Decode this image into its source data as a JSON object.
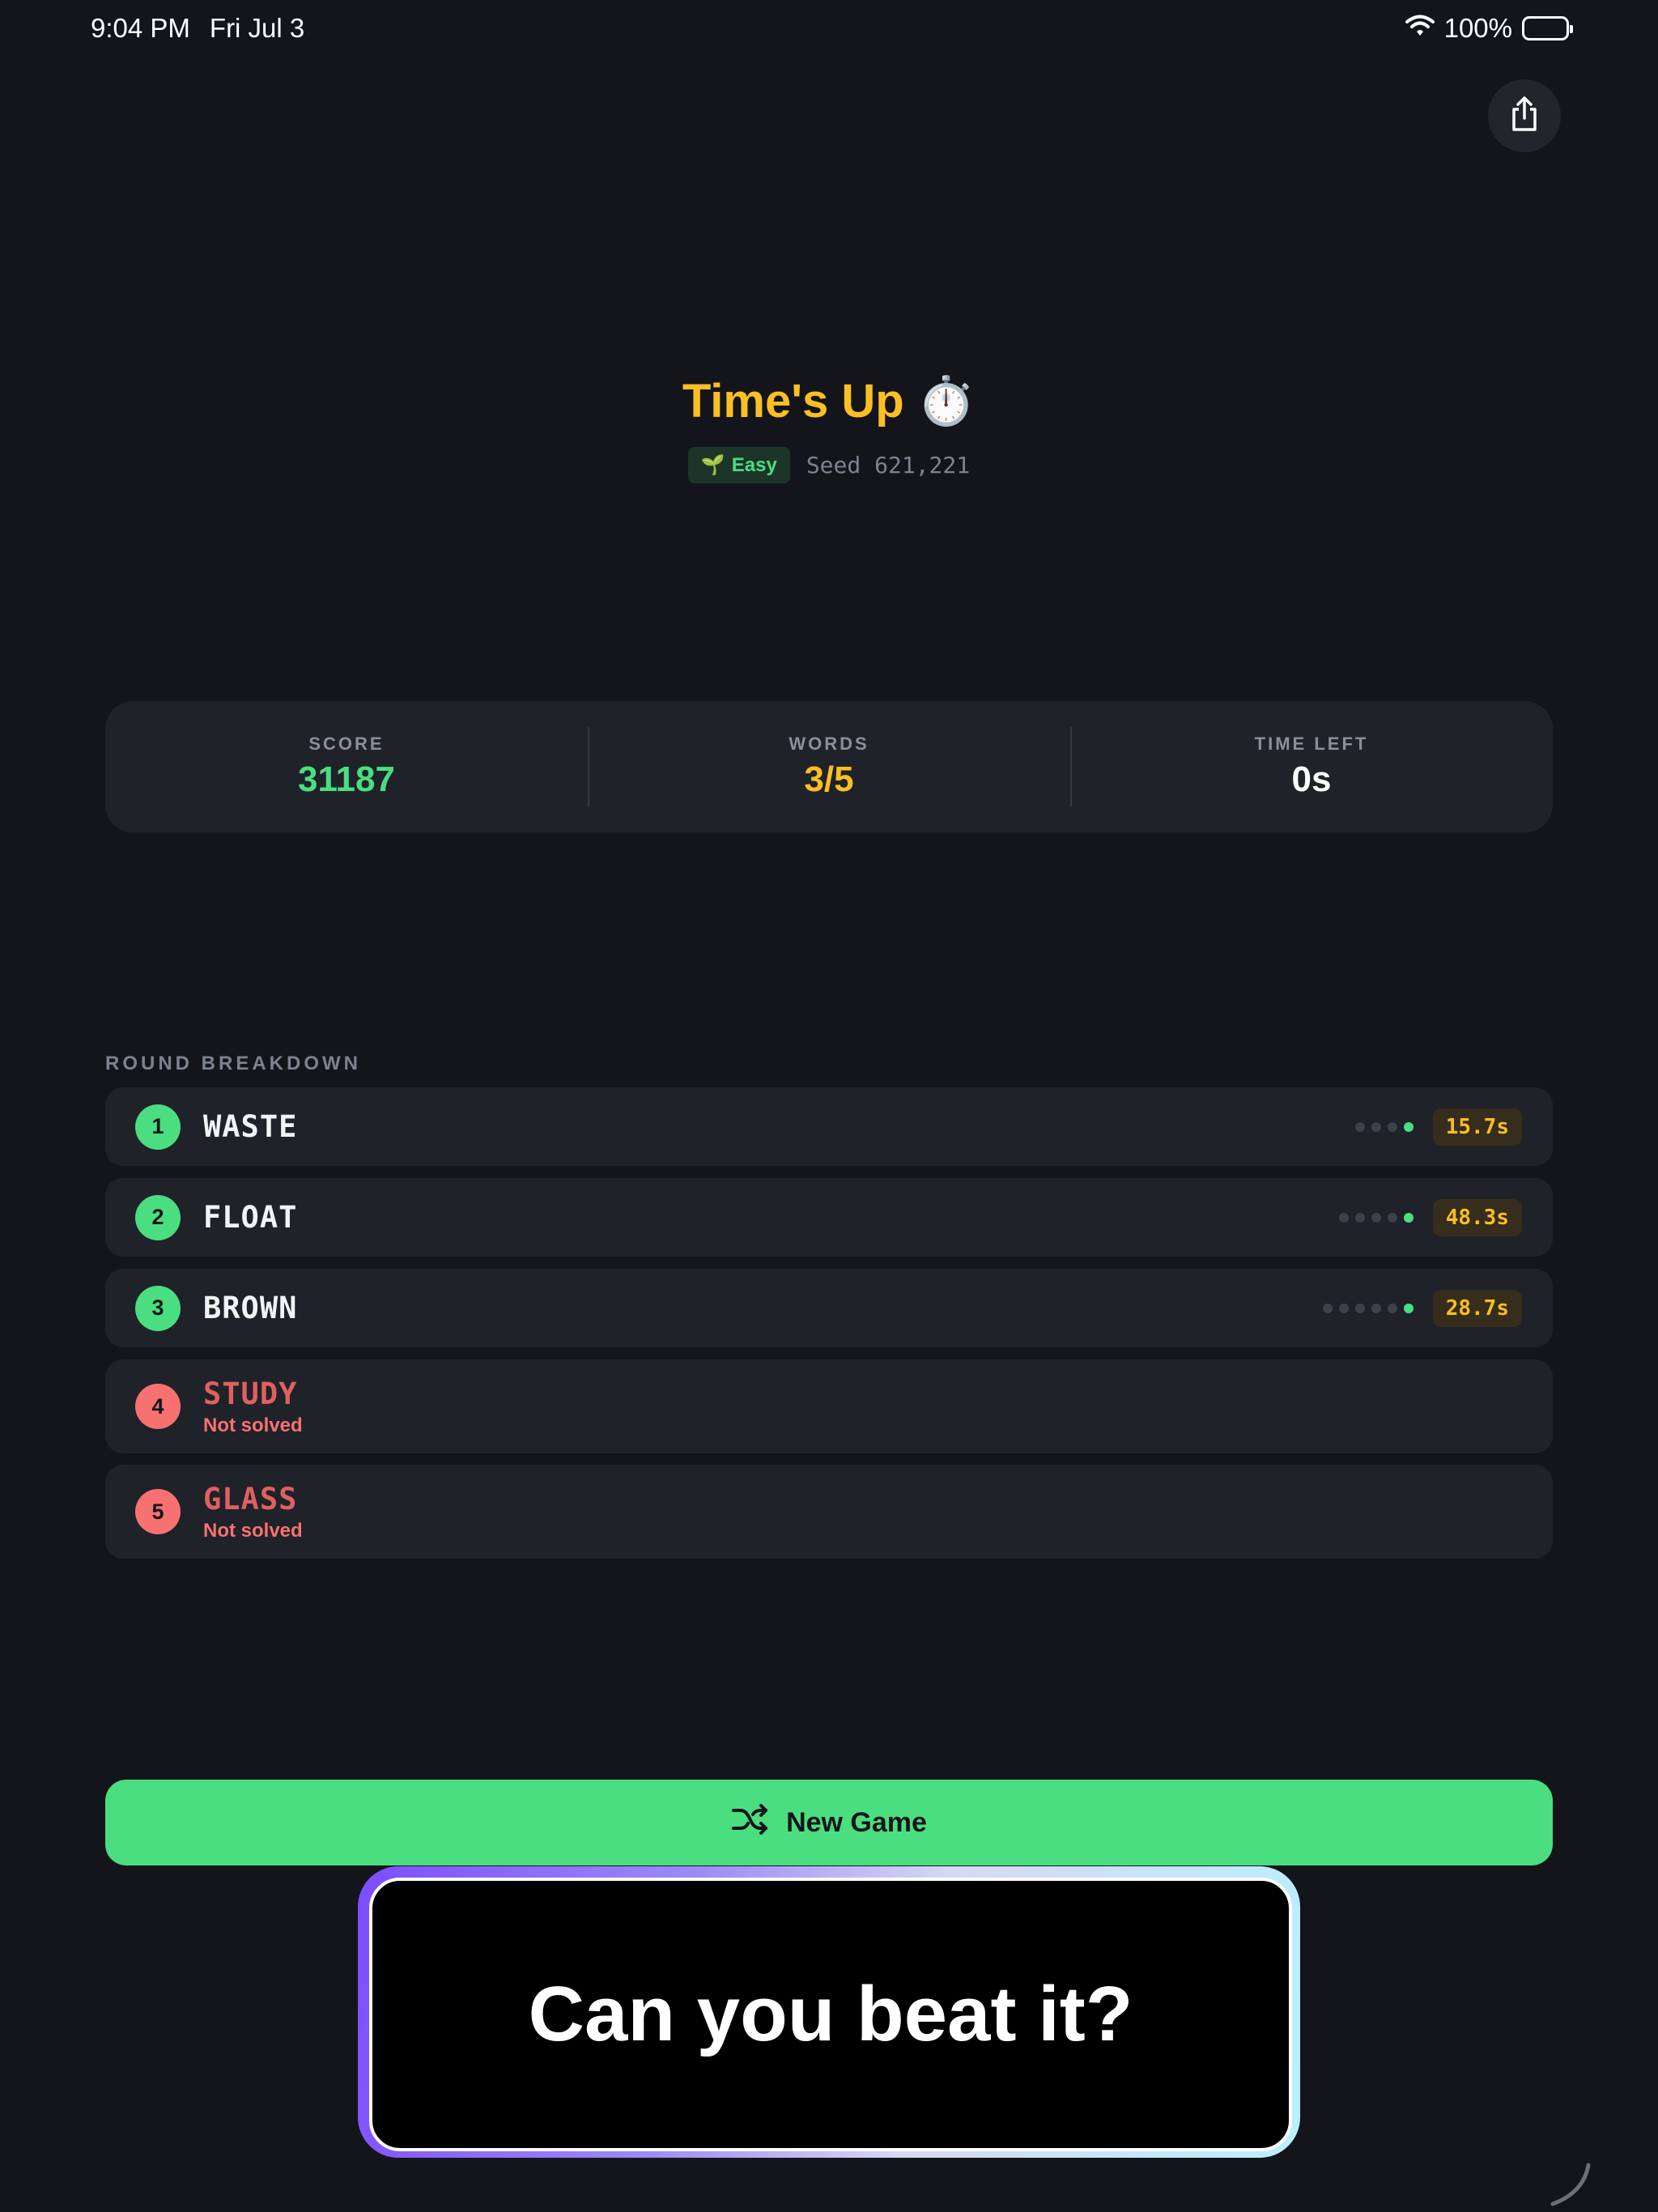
{
  "status_bar": {
    "time": "9:04 PM",
    "date": "Fri Jul 3",
    "battery": "100%"
  },
  "header": {
    "title": "Time's Up ⏱️",
    "difficulty": "Easy",
    "difficulty_icon": "🌱",
    "seed": "Seed 621,221"
  },
  "stats": [
    {
      "label": "SCORE",
      "value": "31187",
      "color": "#4ade80"
    },
    {
      "label": "WORDS",
      "value": "3/5",
      "color": "#fbbf24"
    },
    {
      "label": "TIME LEFT",
      "value": "0s",
      "color": "#ffffff"
    }
  ],
  "breakdown": {
    "label": "ROUND BREAKDOWN",
    "rounds": [
      {
        "num": "1",
        "word": "WASTE",
        "attempts": 4,
        "time": "15.7s"
      },
      {
        "num": "2",
        "word": "FLOAT",
        "attempts": 5,
        "time": "48.3s"
      },
      {
        "num": "3",
        "word": "BROWN",
        "attempts": 6,
        "time": "28.7s"
      },
      {
        "num": "4",
        "word": "STUDY",
        "status": "Not solved"
      },
      {
        "num": "5",
        "word": "GLASS",
        "status": "Not solved"
      }
    ]
  },
  "new_game": {
    "label": "New Game",
    "icon": "shuffle-icon"
  },
  "promo": {
    "text": "Can you beat it?"
  },
  "colors": {
    "accent_green": "#4ade80",
    "accent_yellow": "#fbbf24",
    "accent_red": "#f87171"
  }
}
